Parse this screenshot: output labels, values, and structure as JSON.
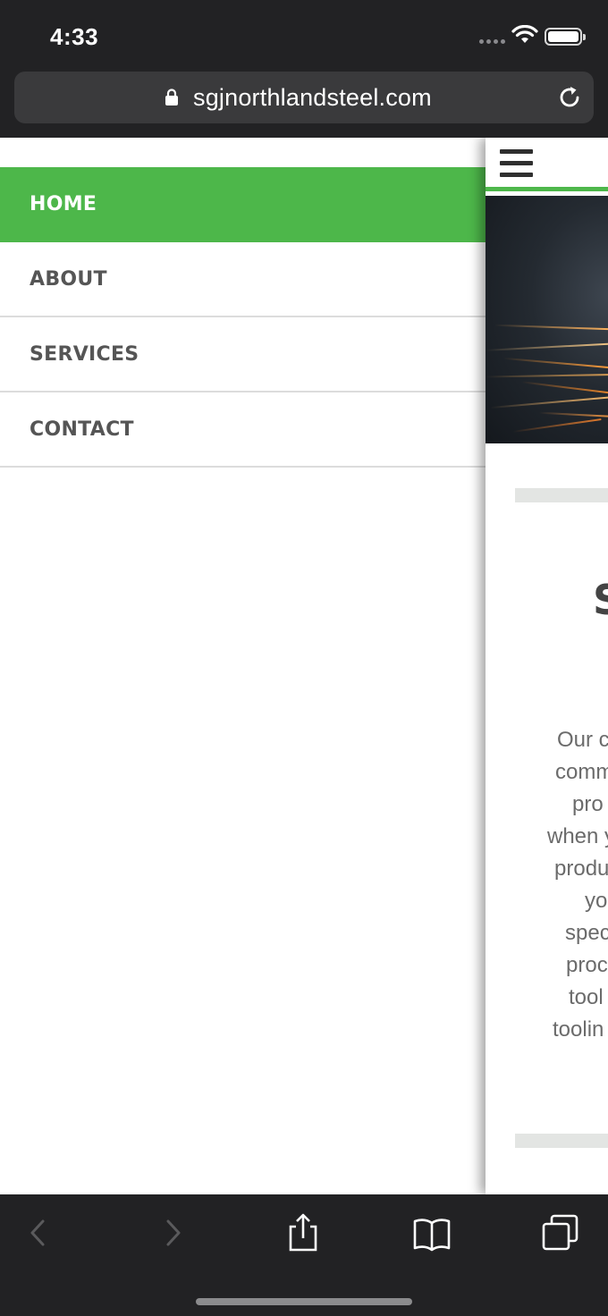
{
  "status_bar": {
    "time": "4:33"
  },
  "browser": {
    "url": "sgjnorthlandsteel.com"
  },
  "menu": {
    "items": [
      {
        "label": "HOME",
        "active": true
      },
      {
        "label": "ABOUT",
        "active": false
      },
      {
        "label": "SERVICES",
        "active": false
      },
      {
        "label": "CONTACT",
        "active": false
      }
    ]
  },
  "content": {
    "heading_fragment": "S",
    "body_fragments": [
      "Our c",
      "comm",
      "pro",
      "when y",
      "produ",
      "yo",
      "spec",
      "proc",
      "tool",
      "toolin"
    ]
  },
  "colors": {
    "accent": "#4db74a",
    "chrome": "#222224",
    "menu_text": "#555555"
  }
}
